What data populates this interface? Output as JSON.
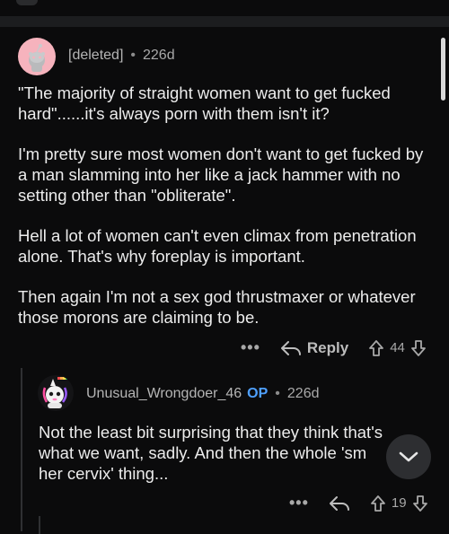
{
  "comment1": {
    "username": "[deleted]",
    "age": "226d",
    "paragraphs": [
      "\"The majority of straight women want to get fucked hard\"......it's always porn with them isn't it?",
      "I'm pretty sure most women don't want to get fucked by a man slamming into her like a jack hammer with no setting other than \"obliterate\".",
      "Hell a lot of women can't even climax from penetration alone. That's why foreplay is important.",
      "Then again I'm not a sex god thrustmaxer or whatever those morons are claiming to be."
    ],
    "more_label": "•••",
    "reply_label": "Reply",
    "votes": "44"
  },
  "comment2": {
    "username": "Unusual_Wrongdoer_46",
    "op_badge": "OP",
    "age": "226d",
    "text_lines": [
      "Not the least bit surprising that they think that's",
      "what we want, sadly. And then the whole 'sm",
      "her cervix' thing..."
    ],
    "more_label": "•••",
    "votes": "19"
  },
  "icons": {
    "deleted_avatar": "snoo-avatar-icon",
    "user_avatar": "unicorn-avatar-icon",
    "reply": "reply-arrow-icon",
    "upvote": "upvote-arrow-icon",
    "downvote": "downvote-arrow-icon",
    "scroll_down": "chevron-down-icon"
  },
  "colors": {
    "background": "#0b0b0c",
    "op": "#4fa0ff",
    "deleted_avatar_bg": "#f6b3bd"
  }
}
